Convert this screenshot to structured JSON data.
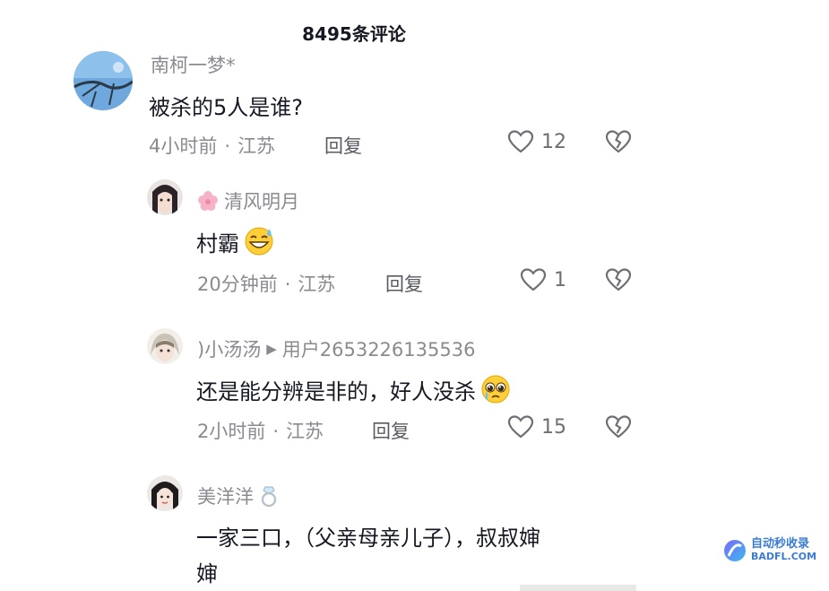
{
  "header": {
    "title": "8495条评论"
  },
  "comments": [
    {
      "username": "南柯一梦*",
      "text": "被杀的5人是谁?",
      "time": "4小时前",
      "location": "江苏",
      "reply_label": "回复",
      "likes": "12"
    },
    {
      "username": "清风明月",
      "text": "村霸",
      "time": "20分钟前",
      "location": "江苏",
      "reply_label": "回复",
      "likes": "1"
    },
    {
      "username": ")小汤汤",
      "reply_to": "用户2653226135536",
      "text": "还是能分辨是非的，好人没杀",
      "time": "2小时前",
      "location": "江苏",
      "reply_label": "回复",
      "likes": "15"
    },
    {
      "username": "美洋洋",
      "text_line1": "一家三口，（父亲母亲儿子），叔叔婶",
      "text_line2": "婶"
    }
  ],
  "watermark": {
    "line1": "自动秒收录",
    "line2": "BADFL.COM"
  },
  "colors": {
    "text": "#161823",
    "muted": "#8a8b91",
    "accent": "#3a7bd5"
  },
  "icons": [
    "heart-icon",
    "broken-heart-icon",
    "play-arrow-icon",
    "grin-sweat-emoji",
    "pleading-emoji",
    "ring-emoji",
    "cherry-blossom-icon"
  ]
}
